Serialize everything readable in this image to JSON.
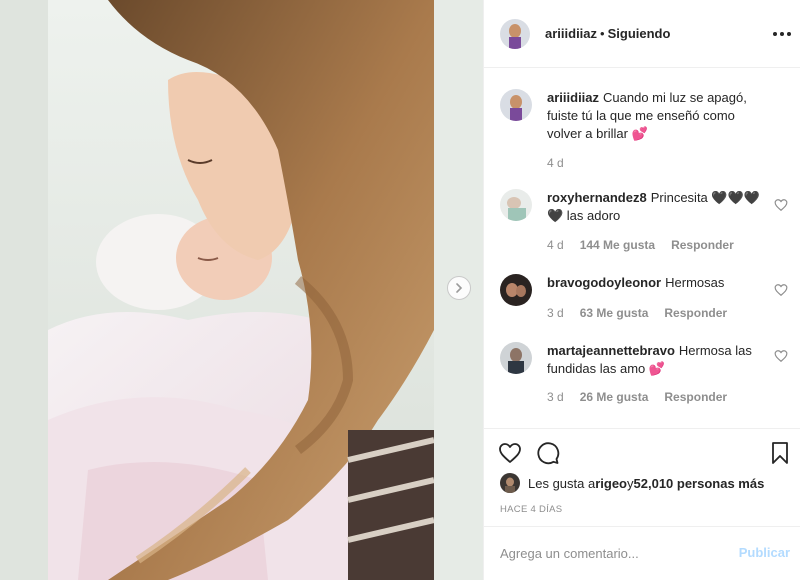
{
  "post": {
    "username": "ariiidiiaz",
    "separator": "•",
    "follow_status": "Siguiendo"
  },
  "caption": {
    "username": "ariiidiiaz",
    "text": "Cuando mi luz se apagó, fuiste tú la que me enseñó como volver a brillar 💕",
    "time": "4 d"
  },
  "comments": [
    {
      "username": "roxyhernandez8",
      "text": "Princesita 🖤🖤🖤 🖤 las adoro",
      "time": "4 d",
      "likes": "144 Me gusta",
      "reply": "Responder"
    },
    {
      "username": "bravogodoyleonor",
      "text": "Hermosas",
      "time": "3 d",
      "likes": "63 Me gusta",
      "reply": "Responder"
    },
    {
      "username": "martajeannettebravo",
      "text": "Hermosa las fundidas las amo 💕",
      "time": "3 d",
      "likes": "26 Me gusta",
      "reply": "Responder"
    }
  ],
  "likes_line": {
    "prefix": "Les gusta a ",
    "user": "rigeo",
    "connector": " y ",
    "count_text": "52,010 personas más"
  },
  "time_ago": "HACE 4 DÍAS",
  "comment_box": {
    "placeholder": "Agrega un comentario...",
    "post_label": "Publicar"
  },
  "icons": {
    "more": "more-horizontal-icon",
    "next": "chevron-right-icon",
    "like": "heart-outline-icon",
    "comment": "speech-bubble-icon",
    "save": "bookmark-icon"
  },
  "colors": {
    "post_disabled": "#b3dbff",
    "secondary_text": "#8e8e8e",
    "divider": "#efefef"
  }
}
